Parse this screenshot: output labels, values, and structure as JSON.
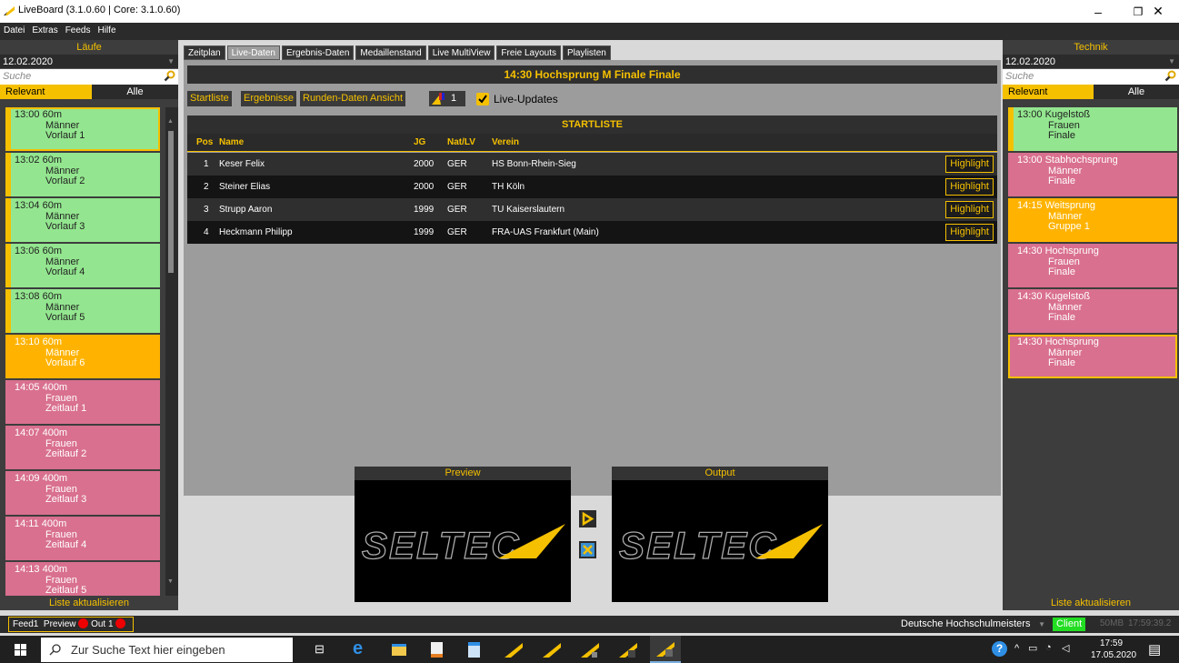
{
  "window": {
    "title": "LiveBoard (3.1.0.60 | Core: 3.1.0.60)",
    "minimize": "–",
    "maximize": "❐",
    "close": "✕"
  },
  "menu": [
    "Datei",
    "Extras",
    "Feeds",
    "Hilfe"
  ],
  "left": {
    "header": "Läufe",
    "date": "12.02.2020",
    "search_placeholder": "Suche",
    "filter_relevant": "Relevant",
    "filter_all": "Alle",
    "events": [
      {
        "time": "13:00 60m",
        "cat": "Männer",
        "round": "Vorlauf 1",
        "color": "green",
        "selected": true
      },
      {
        "time": "13:02 60m",
        "cat": "Männer",
        "round": "Vorlauf 2",
        "color": "green"
      },
      {
        "time": "13:04 60m",
        "cat": "Männer",
        "round": "Vorlauf 3",
        "color": "green"
      },
      {
        "time": "13:06 60m",
        "cat": "Männer",
        "round": "Vorlauf 4",
        "color": "green"
      },
      {
        "time": "13:08 60m",
        "cat": "Männer",
        "round": "Vorlauf 5",
        "color": "green"
      },
      {
        "time": "13:10 60m",
        "cat": "Männer",
        "round": "Vorlauf 6",
        "color": "orange"
      },
      {
        "time": "14:05 400m",
        "cat": "Frauen",
        "round": "Zeitlauf 1",
        "color": "pink"
      },
      {
        "time": "14:07 400m",
        "cat": "Frauen",
        "round": "Zeitlauf 2",
        "color": "pink"
      },
      {
        "time": "14:09 400m",
        "cat": "Frauen",
        "round": "Zeitlauf 3",
        "color": "pink"
      },
      {
        "time": "14:11 400m",
        "cat": "Frauen",
        "round": "Zeitlauf 4",
        "color": "pink"
      },
      {
        "time": "14:13 400m",
        "cat": "Frauen",
        "round": "Zeitlauf 5",
        "color": "pink"
      }
    ],
    "refresh": "Liste aktualisieren"
  },
  "right": {
    "header": "Technik",
    "date": "12.02.2020",
    "search_placeholder": "Suche",
    "filter_relevant": "Relevant",
    "filter_all": "Alle",
    "events": [
      {
        "time": "13:00 Kugelstoß",
        "cat": "Frauen",
        "round": "Finale",
        "color": "green"
      },
      {
        "time": "13:00 Stabhochsprung",
        "cat": "Männer",
        "round": "Finale",
        "color": "pink"
      },
      {
        "time": "14:15 Weitsprung",
        "cat": "Männer",
        "round": "Gruppe 1",
        "color": "orange"
      },
      {
        "time": "14:30 Hochsprung",
        "cat": "Frauen",
        "round": "Finale",
        "color": "pink"
      },
      {
        "time": "14:30 Kugelstoß",
        "cat": "Männer",
        "round": "Finale",
        "color": "pink"
      },
      {
        "time": "14:30 Hochsprung",
        "cat": "Männer",
        "round": "Finale",
        "color": "pink",
        "selected": true
      }
    ],
    "refresh": "Liste aktualisieren"
  },
  "tabs": [
    {
      "label": "Zeitplan"
    },
    {
      "label": "Live-Daten",
      "active": true
    },
    {
      "label": "Ergebnis-Daten"
    },
    {
      "label": "Medaillenstand"
    },
    {
      "label": "Live MultiView"
    },
    {
      "label": "Freie Layouts"
    },
    {
      "label": "Playlisten"
    }
  ],
  "live": {
    "event_title": "14:30 Hochsprung  M Finale Finale",
    "btn_startliste": "Startliste",
    "btn_ergebnisse": "Ergebnisse",
    "btn_runden": "Runden-Daten Ansicht",
    "feed_count": "1",
    "live_updates": "Live-Updates",
    "section": "STARTLISTE",
    "columns": {
      "pos": "Pos",
      "name": "Name",
      "jg": "JG",
      "nat": "Nat/LV",
      "verein": "Verein"
    },
    "rows": [
      {
        "pos": "1",
        "name": "Keser Felix",
        "jg": "2000",
        "nat": "GER",
        "verein": "HS Bonn-Rhein-Sieg",
        "hl": "Highlight"
      },
      {
        "pos": "2",
        "name": "Steiner Elias",
        "jg": "2000",
        "nat": "GER",
        "verein": "TH Köln",
        "hl": "Highlight"
      },
      {
        "pos": "3",
        "name": "Strupp Aaron",
        "jg": "1999",
        "nat": "GER",
        "verein": "TU Kaiserslautern",
        "hl": "Highlight"
      },
      {
        "pos": "4",
        "name": "Heckmann Philipp",
        "jg": "1999",
        "nat": "GER",
        "verein": "FRA-UAS Frankfurt (Main)",
        "hl": "Highlight"
      }
    ]
  },
  "monitors": {
    "preview": "Preview",
    "output": "Output",
    "logo": "SELTEC"
  },
  "status": {
    "feed": "Feed1",
    "preview": "Preview",
    "out": "Out 1",
    "competition": "Deutsche Hochschulmeisters",
    "client": "Client",
    "mem": "50MB",
    "time": "17:59:39.2"
  },
  "taskbar": {
    "search_placeholder": "Zur Suche Text hier eingeben",
    "clock": "17:59",
    "date": "17.05.2020"
  },
  "colors": {
    "accent": "#f5c000",
    "green": "#93e68f",
    "pink": "#d9708f",
    "orange": "#ffb300"
  }
}
